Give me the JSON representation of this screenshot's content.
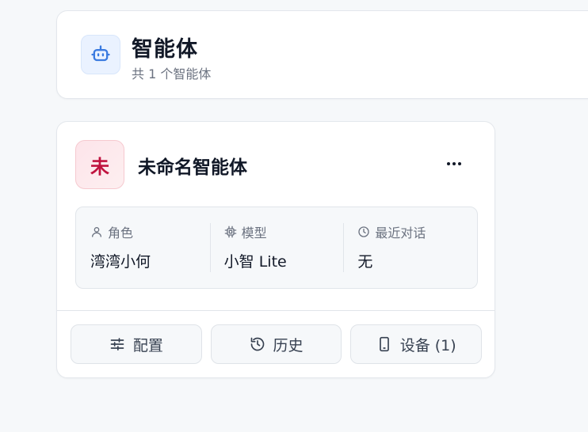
{
  "header": {
    "title": "智能体",
    "subtitle": "共 1 个智能体",
    "icon": "robot-icon",
    "accent": "#3b7be0"
  },
  "agent": {
    "avatar_char": "未",
    "avatar_color": "#c0133f",
    "name": "未命名智能体",
    "more_label": "•••",
    "info": {
      "role": {
        "label": "角色",
        "value": "湾湾小何",
        "icon": "user-icon"
      },
      "model": {
        "label": "模型",
        "value": "小智 Lite",
        "icon": "chip-icon"
      },
      "recent": {
        "label": "最近对话",
        "value": "无",
        "icon": "clock-icon"
      }
    },
    "actions": {
      "config": {
        "label": "配置",
        "icon": "sliders-icon"
      },
      "history": {
        "label": "历史",
        "icon": "history-icon"
      },
      "devices": {
        "label": "设备 (1)",
        "icon": "phone-icon"
      }
    }
  }
}
